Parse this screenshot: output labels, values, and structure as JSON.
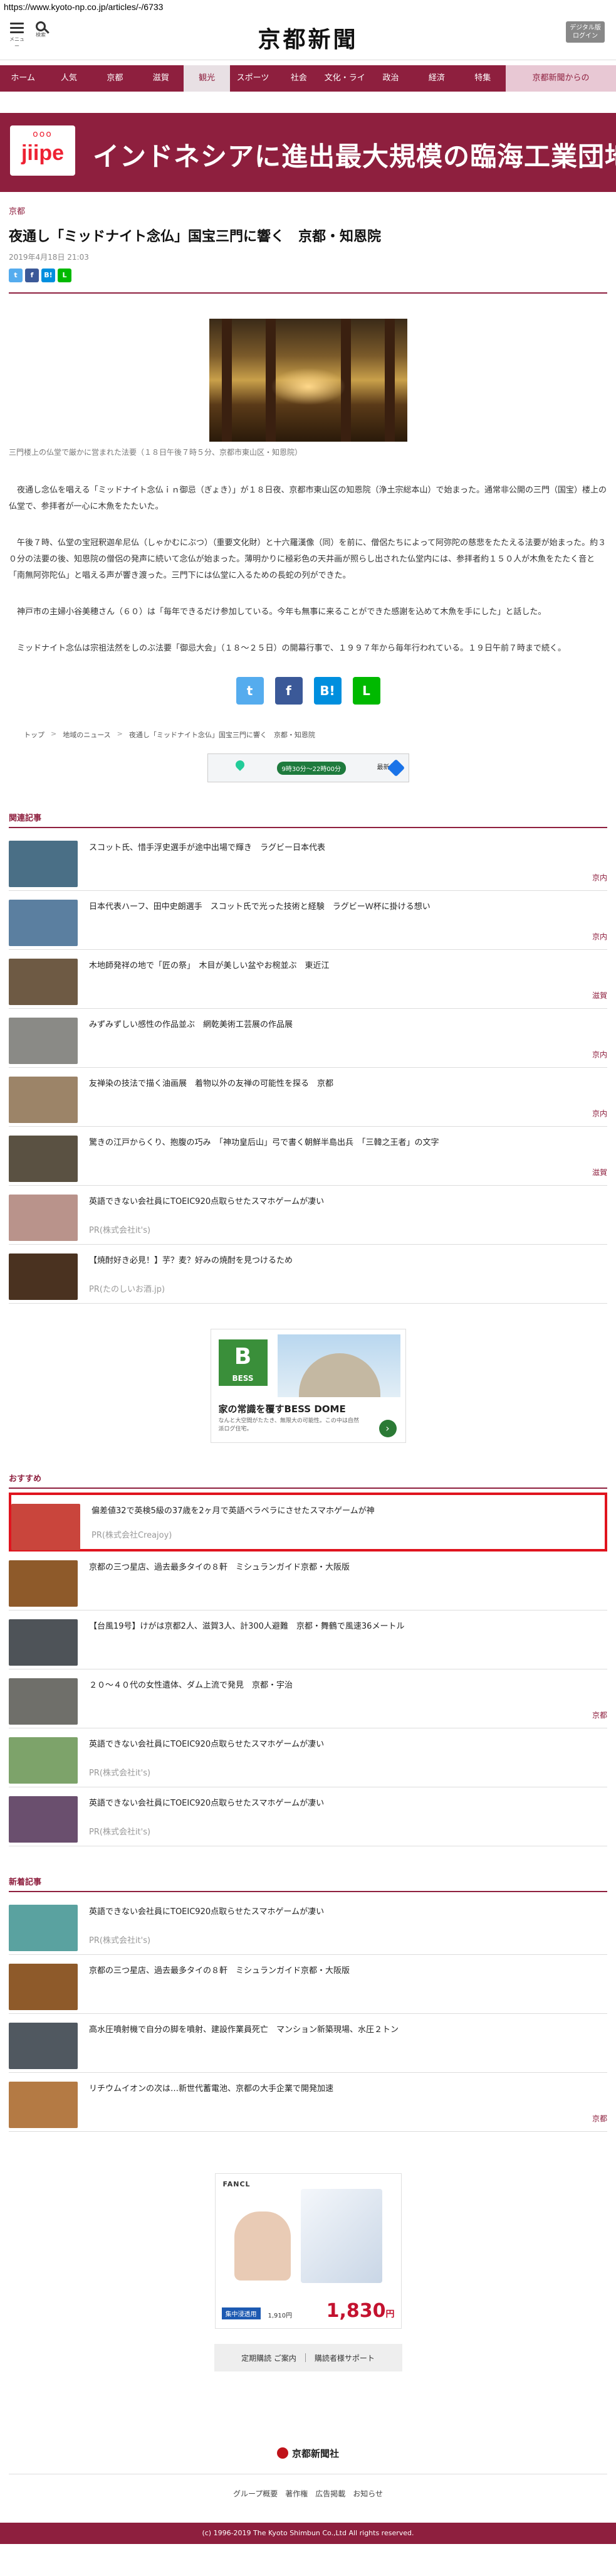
{
  "browser": {
    "url": "https://www.kyoto-np.co.jp/articles/-/6733"
  },
  "header": {
    "menu_label": "メニュー",
    "search_label": "検索",
    "logo": "京都新聞",
    "digital_line1": "デジタル版",
    "digital_line2": "ログイン"
  },
  "nav": [
    "ホーム",
    "人気",
    "京都",
    "滋賀",
    "観光",
    "スポーツ",
    "社会",
    "文化・ライフ",
    "政治",
    "経済",
    "特集",
    "京都新聞からの"
  ],
  "top_ad": {
    "brand_mark": "ooo",
    "brand": "jiipe",
    "text": "インドネシアに進出最大規模の臨海工業団地"
  },
  "article": {
    "section": "京都",
    "title": "夜通し「ミッドナイト念仏」国宝三門に響く　京都・知恩院",
    "date": "2019年4月18日 21:03",
    "share_small": [
      "t",
      "f",
      "B!",
      "L"
    ],
    "caption": "三門楼上の仏堂で厳かに営まれた法要（１８日午後７時５分、京都市東山区・知恩院）",
    "paragraphs": [
      "夜通し念仏を唱える「ミッドナイト念仏ｉｎ御忌（ぎょき）」が１８日夜、京都市東山区の知恩院（浄土宗総本山）で始まった。通常非公開の三門（国宝）楼上の仏堂で、参拝者が一心に木魚をたたいた。",
      "午後７時、仏堂の宝冠釈迦牟尼仏（しゃかむにぶつ）（重要文化財）と十六羅漢像（同）を前に、僧侶たちによって阿弥陀の慈悲をたたえる法要が始まった。約３０分の法要の後、知恩院の僧侶の発声に続いて念仏が始まった。薄明かりに極彩色の天井画が照らし出された仏堂内には、参拝者約１５０人が木魚をたたく音と「南無阿弥陀仏」と唱える声が響き渡った。三門下には仏堂に入るための長蛇の列ができた。",
      "神戸市の主婦小谷美穂さん（６０）は「毎年できるだけ参加している。今年も無事に来ることができた感謝を込めて木魚を手にした」と話した。",
      "ミッドナイト念仏は宗祖法然をしのぶ法要「御忌大会」（１８～２５日）の開幕行事で、１９９７年から毎年行われている。１９日午前７時まで続く。"
    ],
    "share_big": [
      "t",
      "f",
      "B!",
      "L"
    ]
  },
  "breadcrumb": [
    "トップ",
    "地域のニュース",
    "夜通し「ミッドナイト念仏」国宝三門に響く　京都・知恩院"
  ],
  "map_ad": {
    "pill": "9時30分〜22時00分",
    "text": "最新値"
  },
  "related": {
    "title": "関連記事",
    "items": [
      {
        "text": "スコット氏、惜手浮史選手が途中出場で輝き　ラグビー日本代表",
        "cat": "京内",
        "thumb": "#4a6f86"
      },
      {
        "text": "日本代表ハーフ、田中史朗選手　スコット氏で光った技術と経験　ラグビーＷ杯に掛ける想い",
        "cat": "京内",
        "thumb": "#5b7fa0"
      },
      {
        "text": "木地師発祥の地で「匠の祭」　木目が美しい盆やお椀並ぶ　東近江",
        "cat": "滋賀",
        "thumb": "#6e5a44"
      },
      {
        "text": "みずみずしい感性の作品並ぶ　網乾美術工芸展の作品展",
        "cat": "京内",
        "thumb": "#8a8a86"
      },
      {
        "text": "友禅染の技法で描く油画展　着物以外の友禅の可能性を探る　京都",
        "cat": "京内",
        "thumb": "#9c8468"
      },
      {
        "text": "驚きの江戸からくり、抱腹の巧み　「神功皇后山」弓で書く朝鮮半島出兵　「三韓之王者」の文字",
        "cat": "滋賀",
        "thumb": "#5a5142"
      },
      {
        "text": "英語できない会社員にTOEIC920点取らせたスマホゲームが凄い",
        "pr": "PR(株式会社it's)",
        "thumb": "#b9938b"
      },
      {
        "text": "【焼酎好き必見！】芋？麦？好みの焼酎を見つけるため",
        "pr": "PR(たのしいお酒.jp)",
        "thumb": "#4a3220"
      }
    ]
  },
  "mid_ad": {
    "logo": "B",
    "logo_sub": "BESS",
    "title": "家の常識を覆すBESS DOME",
    "sub": "なんと大空間がたたき、無限大の可能性。この中は自然派ログ住宅。"
  },
  "recommend": {
    "title": "おすすめ",
    "items": [
      {
        "text": "偏差値32で英検5級の37歳を2ヶ月で英語ペラペラにさせたスマホゲームが神",
        "pr": "PR(株式会社Creajoy)",
        "thumb": "#c9453c",
        "highlight": true
      },
      {
        "text": "京都の三つ星店、過去最多タイの８軒　ミシュランガイド京都・大阪版",
        "thumb": "#8e5a2a"
      },
      {
        "text": "【台風19号】けがは京都2人、滋賀3人、計300人避難　京都・舞鶴で風速36メートル",
        "thumb": "#4e5358"
      },
      {
        "text": "２０～４０代の女性遺体、ダム上流で発見　京都・宇治",
        "cat": "京都",
        "thumb": "#6f6f6a"
      },
      {
        "text": "英語できない会社員にTOEIC920点取らせたスマホゲームが凄い",
        "pr": "PR(株式会社it's)",
        "thumb": "#7da36a"
      },
      {
        "text": "英語できない会社員にTOEIC920点取らせたスマホゲームが凄い",
        "pr": "PR(株式会社it's)",
        "thumb": "#6a4f6e"
      }
    ]
  },
  "latest": {
    "title": "新着記事",
    "items": [
      {
        "text": "英語できない会社員にTOEIC920点取らせたスマホゲームが凄い",
        "pr": "PR(株式会社it's)",
        "thumb": "#5aa2a0"
      },
      {
        "text": "京都の三つ星店、過去最多タイの８軒　ミシュランガイド京都・大阪版",
        "thumb": "#8e5a2a"
      },
      {
        "text": "高水圧噴射機で自分の脚を噴射、建設作業員死亡　マンション新築現場、水圧２トン",
        "thumb": "#505860"
      },
      {
        "text": "リチウムイオンの次は…新世代蓄電池、京都の大手企業で開発加速",
        "cat": "京都",
        "thumb": "#b47a44"
      }
    ]
  },
  "footer_ad": {
    "logo": "FANCL",
    "tag": "集中浸透用",
    "tag2": "1,910円",
    "price": "1,830",
    "price_unit": "円"
  },
  "sub_links": [
    "定期購読 ご案内",
    "購読者様サポート"
  ],
  "footer": {
    "logo": "京都新聞社",
    "links": [
      "グループ概要",
      "著作権",
      "広告掲載",
      "お知らせ"
    ],
    "copyright": "(c) 1996-2019 The Kyoto Shimbun Co.,Ltd All rights reserved."
  },
  "colors": {
    "brand": "#8e1f3e",
    "highlight": "#e0141e",
    "twitter": "#55acee",
    "facebook": "#3b5998",
    "hatena": "#008fde",
    "line": "#00b900"
  }
}
